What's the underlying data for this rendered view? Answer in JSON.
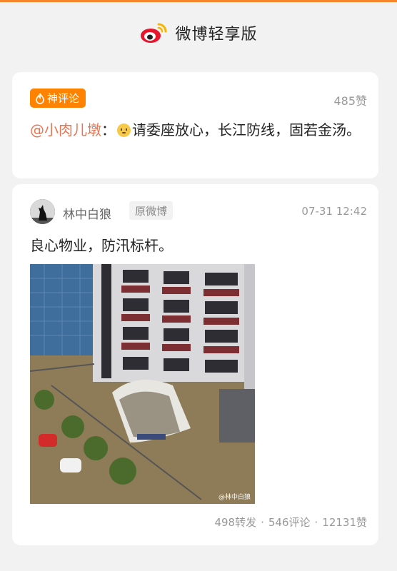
{
  "header": {
    "app_title": "微博轻享版"
  },
  "hot_comment": {
    "badge": "神评论",
    "likes": "485赞",
    "mention": "@小肉儿墩",
    "separator": "：",
    "text": "请委座放心，长江防线，固若金汤。"
  },
  "post": {
    "author": "林中白狼",
    "tag": "原微博",
    "time": "07-31 12:42",
    "text": "良心物业，防汛标杆。",
    "image_watermark": "@林中白狼",
    "reposts": "498转发",
    "comments": "546评论",
    "likes": "12131赞",
    "dot": "·"
  },
  "colors": {
    "accent": "#ff8200",
    "mention": "#eb7350",
    "top_bar": "#f7852b"
  }
}
